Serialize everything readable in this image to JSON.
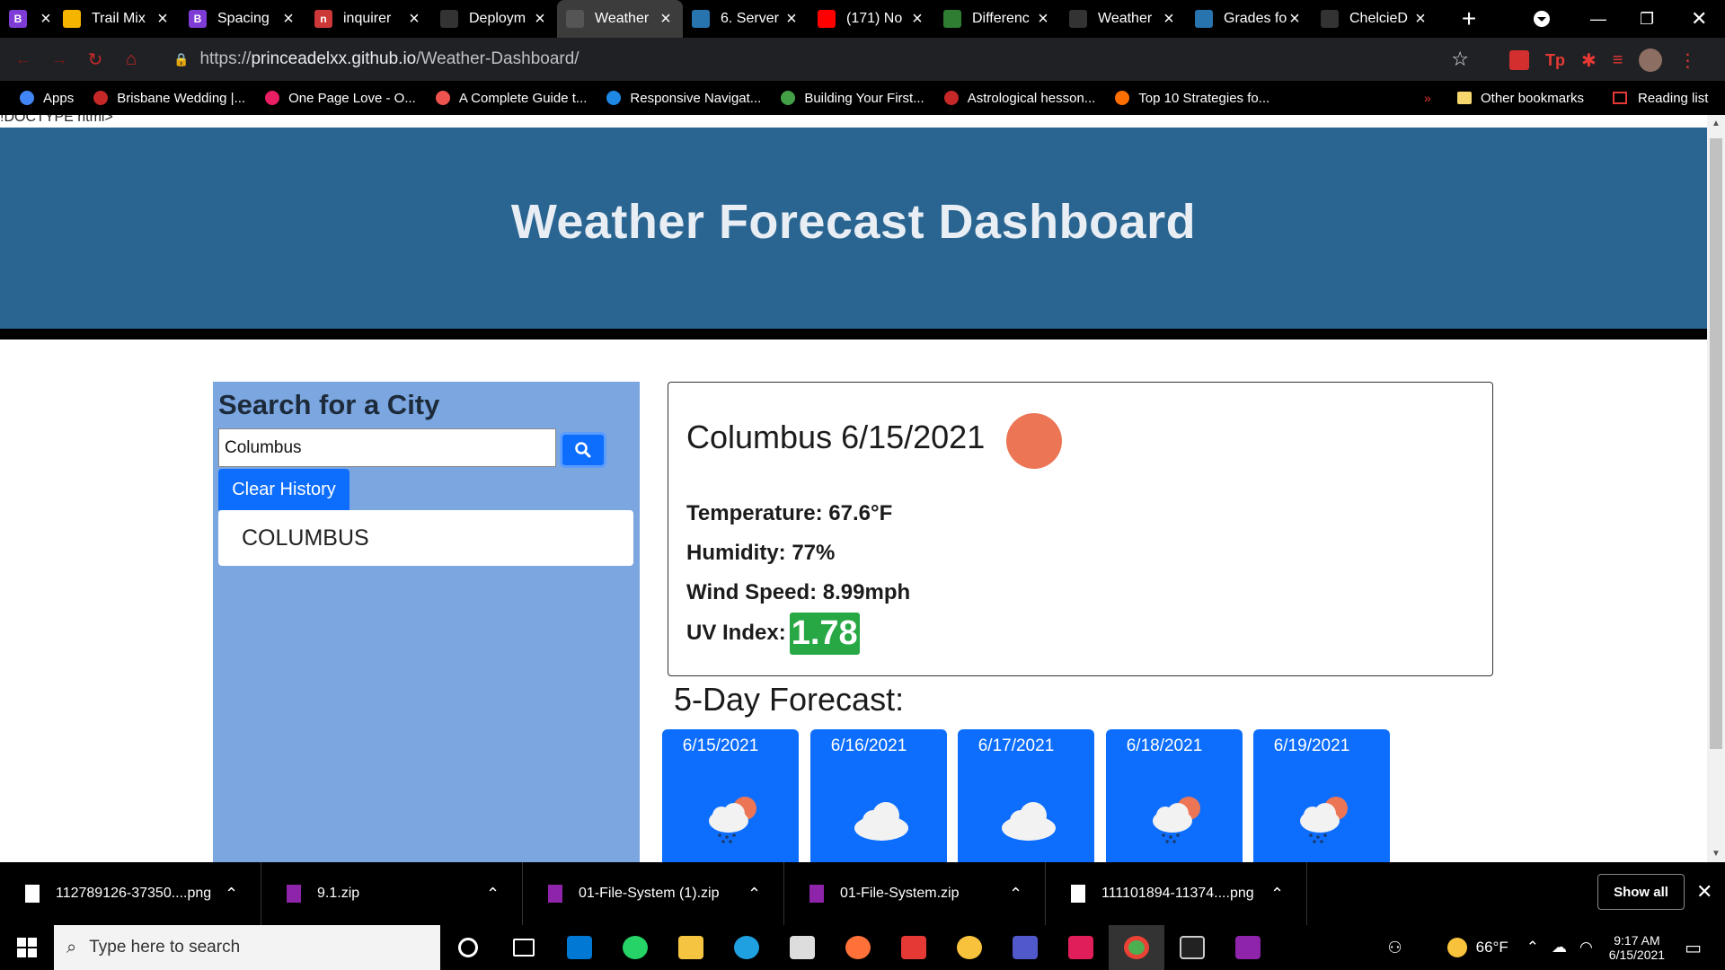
{
  "browser": {
    "tabs": [
      {
        "title": "",
        "color": "#7e3bd6",
        "letter": "B",
        "active": false
      },
      {
        "title": "Trail Mix",
        "color": "#f5b400",
        "letter": "",
        "active": false
      },
      {
        "title": "Spacing",
        "color": "#7e3bd6",
        "letter": "B",
        "active": false
      },
      {
        "title": "inquirer",
        "color": "#cb3837",
        "letter": "n",
        "active": false
      },
      {
        "title": "Deploym",
        "color": "#333333",
        "letter": "",
        "active": false
      },
      {
        "title": "Weather",
        "color": "#555555",
        "letter": "",
        "active": true
      },
      {
        "title": "6. Server",
        "color": "#2774ae",
        "letter": "",
        "active": false
      },
      {
        "title": "(171) No",
        "color": "#ff0000",
        "letter": "",
        "active": false
      },
      {
        "title": "Differenc",
        "color": "#2e7d32",
        "letter": "",
        "active": false
      },
      {
        "title": "Weather",
        "color": "#333333",
        "letter": "",
        "active": false
      },
      {
        "title": "Grades fo",
        "color": "#2774ae",
        "letter": "",
        "active": false
      },
      {
        "title": "ChelcieD",
        "color": "#333333",
        "letter": "",
        "active": false
      }
    ],
    "url_host": "princeadelxx.github.io",
    "url_path": "/Weather-Dashboard/",
    "url_scheme": "https://",
    "bookmarks": [
      {
        "label": "Apps",
        "color": "#4285f4"
      },
      {
        "label": "Brisbane Wedding |...",
        "color": "#c62828"
      },
      {
        "label": "One Page Love - O...",
        "color": "#e91e63"
      },
      {
        "label": "A Complete Guide t...",
        "color": "#ef5350"
      },
      {
        "label": "Responsive Navigat...",
        "color": "#1e88e5"
      },
      {
        "label": "Building Your First...",
        "color": "#43a047"
      },
      {
        "label": "Astrological hesson...",
        "color": "#c62828"
      },
      {
        "label": "Top 10 Strategies fo...",
        "color": "#ff6f00"
      }
    ],
    "other_bookmarks": "Other bookmarks",
    "reading_list": "Reading list",
    "overflow": "»"
  },
  "page": {
    "doctype_text": "!DOCTYPE html>",
    "header_title": "Weather Forecast Dashboard",
    "search": {
      "heading": "Search for a City",
      "input_value": "Columbus",
      "clear_label": "Clear History",
      "history": [
        "COLUMBUS"
      ]
    },
    "current": {
      "title": "Columbus 6/15/2021",
      "temperature": "Temperature: 67.6°F",
      "humidity": "Humidity: 77%",
      "wind": "Wind Speed: 8.99mph",
      "uv_label": "UV Index:",
      "uv_value": "1.78",
      "uv_color": "#28a745",
      "icon": "sun-icon",
      "icon_color": "#ec7555"
    },
    "forecast": {
      "title": "5-Day Forecast:",
      "days": [
        {
          "date": "6/15/2021",
          "icon": "sun-rain-cloud-icon"
        },
        {
          "date": "6/16/2021",
          "icon": "cloud-icon"
        },
        {
          "date": "6/17/2021",
          "icon": "cloud-icon"
        },
        {
          "date": "6/18/2021",
          "icon": "sun-rain-cloud-icon"
        },
        {
          "date": "6/19/2021",
          "icon": "sun-rain-cloud-icon"
        }
      ],
      "card_color": "#0d6efd"
    },
    "header_color": "#2a6591",
    "sidebar_color": "#7ba6e0"
  },
  "downloads": {
    "items": [
      {
        "name": "112789126-37350....png",
        "type": "image"
      },
      {
        "name": "9.1.zip",
        "type": "zip"
      },
      {
        "name": "01-File-System (1).zip",
        "type": "zip"
      },
      {
        "name": "01-File-System.zip",
        "type": "zip"
      },
      {
        "name": "111101894-11374....png",
        "type": "image"
      }
    ],
    "show_all": "Show all"
  },
  "taskbar": {
    "search_placeholder": "Type here to search",
    "weather": "66°F",
    "time": "9:17 AM",
    "date": "6/15/2021"
  }
}
